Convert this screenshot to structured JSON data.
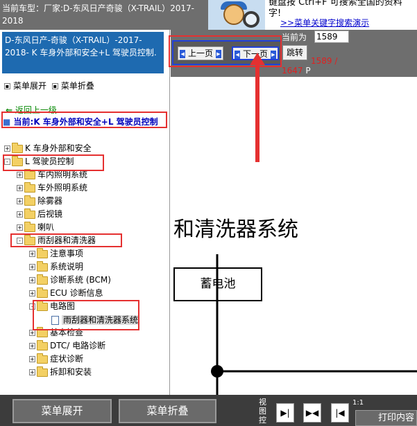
{
  "header": {
    "car_model": "当前车型：厂家:D-东风日产奇骏（X-TRAIL）2017-2018",
    "hint_line1": "键盘按   Ctrl+F   可搜索全国的资料",
    "hint_line2": "字!",
    "demo_link": ">>菜单关键字搜索演示"
  },
  "sidebar": {
    "breadcrumb": "D-东风日产-奇骏（X-TRAIL）-2017-2018- K 车身外部和安全+L 驾驶员控制.",
    "expand_label": "菜单展开",
    "collapse_label": "菜单折叠",
    "back_label": "返回上一级",
    "current_label": "当前:K 车身外部和安全+L 驾驶员控制",
    "tree": [
      {
        "label": "K 车身外部和安全",
        "toggle": "+"
      },
      {
        "label": "L 驾驶员控制",
        "toggle": "-"
      },
      {
        "label": "车内照明系统",
        "toggle": "+"
      },
      {
        "label": "车外照明系统",
        "toggle": "+"
      },
      {
        "label": "除雾器",
        "toggle": "+"
      },
      {
        "label": "后视镜",
        "toggle": "+"
      },
      {
        "label": "喇叭",
        "toggle": "+"
      },
      {
        "label": "雨刮器和清洗器",
        "toggle": "-"
      },
      {
        "label": "注意事项",
        "toggle": "+"
      },
      {
        "label": "系统说明",
        "toggle": "+"
      },
      {
        "label": "诊断系统 (BCM)",
        "toggle": "+"
      },
      {
        "label": "ECU 诊断信息",
        "toggle": "+"
      },
      {
        "label": "电路图",
        "toggle": "-"
      },
      {
        "label": "雨刮器和清洗器系统",
        "toggle": ""
      },
      {
        "label": "基本检查",
        "toggle": "+"
      },
      {
        "label": "DTC/ 电路诊断",
        "toggle": "+"
      },
      {
        "label": "症状诊断",
        "toggle": "+"
      },
      {
        "label": "拆卸和安装",
        "toggle": "+"
      }
    ]
  },
  "pager": {
    "prev_label": "上一页",
    "next_label": "下一页",
    "current_label": "当前为",
    "current_page": "1589",
    "jump_label": "跳转",
    "page_info": "1589 /",
    "total_pages": "1647",
    "page_suffix": "P"
  },
  "document": {
    "title": "和清洗器系统",
    "battery_label": "蓄电池"
  },
  "bottom": {
    "expand_label": "菜单展开",
    "collapse_label": "菜单折叠",
    "view_label": "视图控",
    "ratio": "1:1",
    "print_label": "打印内容"
  },
  "colors": {
    "accent_blue": "#1e6ab0",
    "highlight_red": "#e53030",
    "toolbar_gray": "#6e6e6e",
    "bottom_dark": "#3c3c3c"
  }
}
